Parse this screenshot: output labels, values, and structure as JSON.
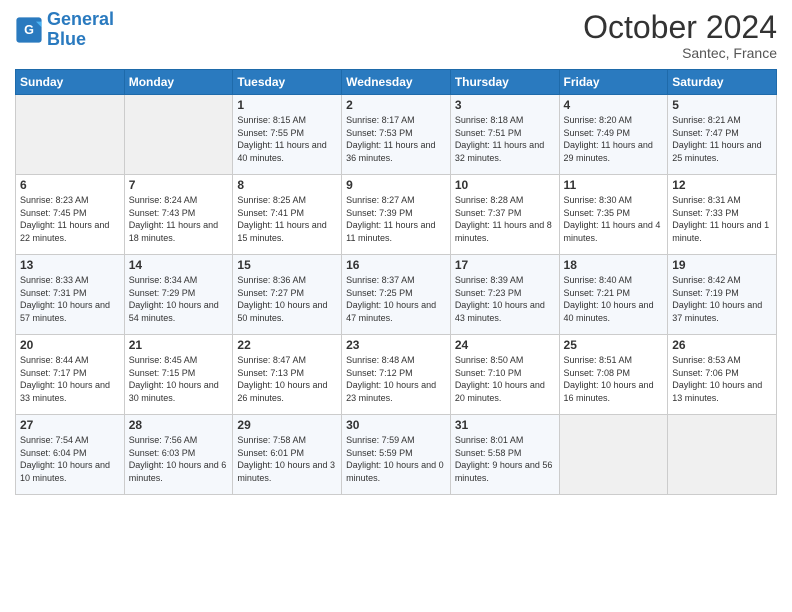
{
  "logo": {
    "line1": "General",
    "line2": "Blue"
  },
  "title": "October 2024",
  "subtitle": "Santec, France",
  "days_header": [
    "Sunday",
    "Monday",
    "Tuesday",
    "Wednesday",
    "Thursday",
    "Friday",
    "Saturday"
  ],
  "weeks": [
    [
      {
        "day": "",
        "detail": ""
      },
      {
        "day": "",
        "detail": ""
      },
      {
        "day": "1",
        "detail": "Sunrise: 8:15 AM\nSunset: 7:55 PM\nDaylight: 11 hours and 40 minutes."
      },
      {
        "day": "2",
        "detail": "Sunrise: 8:17 AM\nSunset: 7:53 PM\nDaylight: 11 hours and 36 minutes."
      },
      {
        "day": "3",
        "detail": "Sunrise: 8:18 AM\nSunset: 7:51 PM\nDaylight: 11 hours and 32 minutes."
      },
      {
        "day": "4",
        "detail": "Sunrise: 8:20 AM\nSunset: 7:49 PM\nDaylight: 11 hours and 29 minutes."
      },
      {
        "day": "5",
        "detail": "Sunrise: 8:21 AM\nSunset: 7:47 PM\nDaylight: 11 hours and 25 minutes."
      }
    ],
    [
      {
        "day": "6",
        "detail": "Sunrise: 8:23 AM\nSunset: 7:45 PM\nDaylight: 11 hours and 22 minutes."
      },
      {
        "day": "7",
        "detail": "Sunrise: 8:24 AM\nSunset: 7:43 PM\nDaylight: 11 hours and 18 minutes."
      },
      {
        "day": "8",
        "detail": "Sunrise: 8:25 AM\nSunset: 7:41 PM\nDaylight: 11 hours and 15 minutes."
      },
      {
        "day": "9",
        "detail": "Sunrise: 8:27 AM\nSunset: 7:39 PM\nDaylight: 11 hours and 11 minutes."
      },
      {
        "day": "10",
        "detail": "Sunrise: 8:28 AM\nSunset: 7:37 PM\nDaylight: 11 hours and 8 minutes."
      },
      {
        "day": "11",
        "detail": "Sunrise: 8:30 AM\nSunset: 7:35 PM\nDaylight: 11 hours and 4 minutes."
      },
      {
        "day": "12",
        "detail": "Sunrise: 8:31 AM\nSunset: 7:33 PM\nDaylight: 11 hours and 1 minute."
      }
    ],
    [
      {
        "day": "13",
        "detail": "Sunrise: 8:33 AM\nSunset: 7:31 PM\nDaylight: 10 hours and 57 minutes."
      },
      {
        "day": "14",
        "detail": "Sunrise: 8:34 AM\nSunset: 7:29 PM\nDaylight: 10 hours and 54 minutes."
      },
      {
        "day": "15",
        "detail": "Sunrise: 8:36 AM\nSunset: 7:27 PM\nDaylight: 10 hours and 50 minutes."
      },
      {
        "day": "16",
        "detail": "Sunrise: 8:37 AM\nSunset: 7:25 PM\nDaylight: 10 hours and 47 minutes."
      },
      {
        "day": "17",
        "detail": "Sunrise: 8:39 AM\nSunset: 7:23 PM\nDaylight: 10 hours and 43 minutes."
      },
      {
        "day": "18",
        "detail": "Sunrise: 8:40 AM\nSunset: 7:21 PM\nDaylight: 10 hours and 40 minutes."
      },
      {
        "day": "19",
        "detail": "Sunrise: 8:42 AM\nSunset: 7:19 PM\nDaylight: 10 hours and 37 minutes."
      }
    ],
    [
      {
        "day": "20",
        "detail": "Sunrise: 8:44 AM\nSunset: 7:17 PM\nDaylight: 10 hours and 33 minutes."
      },
      {
        "day": "21",
        "detail": "Sunrise: 8:45 AM\nSunset: 7:15 PM\nDaylight: 10 hours and 30 minutes."
      },
      {
        "day": "22",
        "detail": "Sunrise: 8:47 AM\nSunset: 7:13 PM\nDaylight: 10 hours and 26 minutes."
      },
      {
        "day": "23",
        "detail": "Sunrise: 8:48 AM\nSunset: 7:12 PM\nDaylight: 10 hours and 23 minutes."
      },
      {
        "day": "24",
        "detail": "Sunrise: 8:50 AM\nSunset: 7:10 PM\nDaylight: 10 hours and 20 minutes."
      },
      {
        "day": "25",
        "detail": "Sunrise: 8:51 AM\nSunset: 7:08 PM\nDaylight: 10 hours and 16 minutes."
      },
      {
        "day": "26",
        "detail": "Sunrise: 8:53 AM\nSunset: 7:06 PM\nDaylight: 10 hours and 13 minutes."
      }
    ],
    [
      {
        "day": "27",
        "detail": "Sunrise: 7:54 AM\nSunset: 6:04 PM\nDaylight: 10 hours and 10 minutes."
      },
      {
        "day": "28",
        "detail": "Sunrise: 7:56 AM\nSunset: 6:03 PM\nDaylight: 10 hours and 6 minutes."
      },
      {
        "day": "29",
        "detail": "Sunrise: 7:58 AM\nSunset: 6:01 PM\nDaylight: 10 hours and 3 minutes."
      },
      {
        "day": "30",
        "detail": "Sunrise: 7:59 AM\nSunset: 5:59 PM\nDaylight: 10 hours and 0 minutes."
      },
      {
        "day": "31",
        "detail": "Sunrise: 8:01 AM\nSunset: 5:58 PM\nDaylight: 9 hours and 56 minutes."
      },
      {
        "day": "",
        "detail": ""
      },
      {
        "day": "",
        "detail": ""
      }
    ]
  ]
}
